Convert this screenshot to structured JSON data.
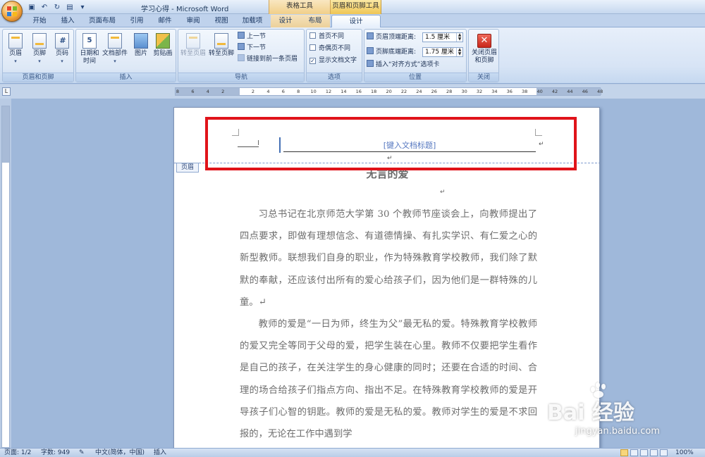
{
  "window": {
    "title": "学习心得 - Microsoft Word",
    "context_tabs": {
      "table_tools": "表格工具",
      "header_footer_tools": "页眉和页脚工具"
    }
  },
  "tabs": [
    {
      "label": "开始"
    },
    {
      "label": "插入"
    },
    {
      "label": "页面布局"
    },
    {
      "label": "引用"
    },
    {
      "label": "邮件"
    },
    {
      "label": "审阅"
    },
    {
      "label": "视图"
    },
    {
      "label": "加载项"
    },
    {
      "label": "设计"
    },
    {
      "label": "布局"
    },
    {
      "label": "设计"
    }
  ],
  "ribbon": {
    "group_header_footer": {
      "label": "页眉和页脚",
      "header": "页眉",
      "footer": "页脚",
      "page_number": "页码"
    },
    "group_insert": {
      "label": "插入",
      "date_time": "日期和时间",
      "quick_parts": "文档部件",
      "picture": "图片",
      "clip_art": "剪贴画"
    },
    "group_navigation": {
      "label": "导航",
      "goto_header": "转至页眉",
      "goto_footer": "转至页脚",
      "prev_section": "上一节",
      "next_section": "下一节",
      "link_previous": "链接到前一条页眉"
    },
    "group_options": {
      "label": "选项",
      "different_first": "首页不同",
      "different_odd_even": "奇偶页不同",
      "show_doc_text": "显示文档文字"
    },
    "group_position": {
      "label": "位置",
      "header_from_top": "页眉顶端距离:",
      "header_from_top_value": "1.5 厘米",
      "footer_from_bottom": "页脚底端距离:",
      "footer_from_bottom_value": "1.75 厘米",
      "insert_align_tab": "插入“对齐方式”选项卡"
    },
    "group_close": {
      "label": "关闭",
      "close_header_footer": "关闭页眉和页脚"
    }
  },
  "ruler": {
    "ticks": [
      "8",
      "6",
      "4",
      "2",
      "",
      "2",
      "4",
      "6",
      "8",
      "10",
      "12",
      "14",
      "16",
      "18",
      "20",
      "22",
      "24",
      "26",
      "28",
      "30",
      "32",
      "34",
      "36",
      "38",
      "40",
      "42",
      "44",
      "46",
      "48"
    ]
  },
  "document": {
    "header_placeholder": "[键入文档标题]",
    "header_tag": "页眉",
    "title": "无言的爱",
    "paragraphs": [
      "习总书记在北京师范大学第 30 个教师节座谈会上，向教师提出了四点要求，即做有理想信念、有道德情操、有扎实学识、有仁爱之心的新型教师。联想我们自身的职业，作为特殊教育学校教师，我们除了默默的奉献，还应该付出所有的爱心给孩子们，因为他们是一群特殊的儿童。↵",
      "教师的爱是“一日为师，终生为父”最无私的爱。特殊教育学校教师的爱又完全等同于父母的爱，把学生装在心里。教师不仅要把学生看作是自己的孩子，在关注学生的身心健康的同时；还要在合适的时间、合理的场合给孩子们指点方向、指出不足。在特殊教育学校教师的爱是开导孩子们心智的钥匙。教师的爱是无私的爱。教师对学生的爱是不求回报的，无论在工作中遇到学"
    ]
  },
  "status": {
    "page": "页面: 1/2",
    "word_count": "字数: 949",
    "language": "中文(简体，中国)",
    "mode": "插入",
    "zoom": "100%"
  },
  "watermark": {
    "main": "Bai 经验",
    "sub": "jingyan.baidu.com"
  },
  "colors": {
    "highlight_box": "#e0131a",
    "header_placeholder": "#5577c0"
  }
}
